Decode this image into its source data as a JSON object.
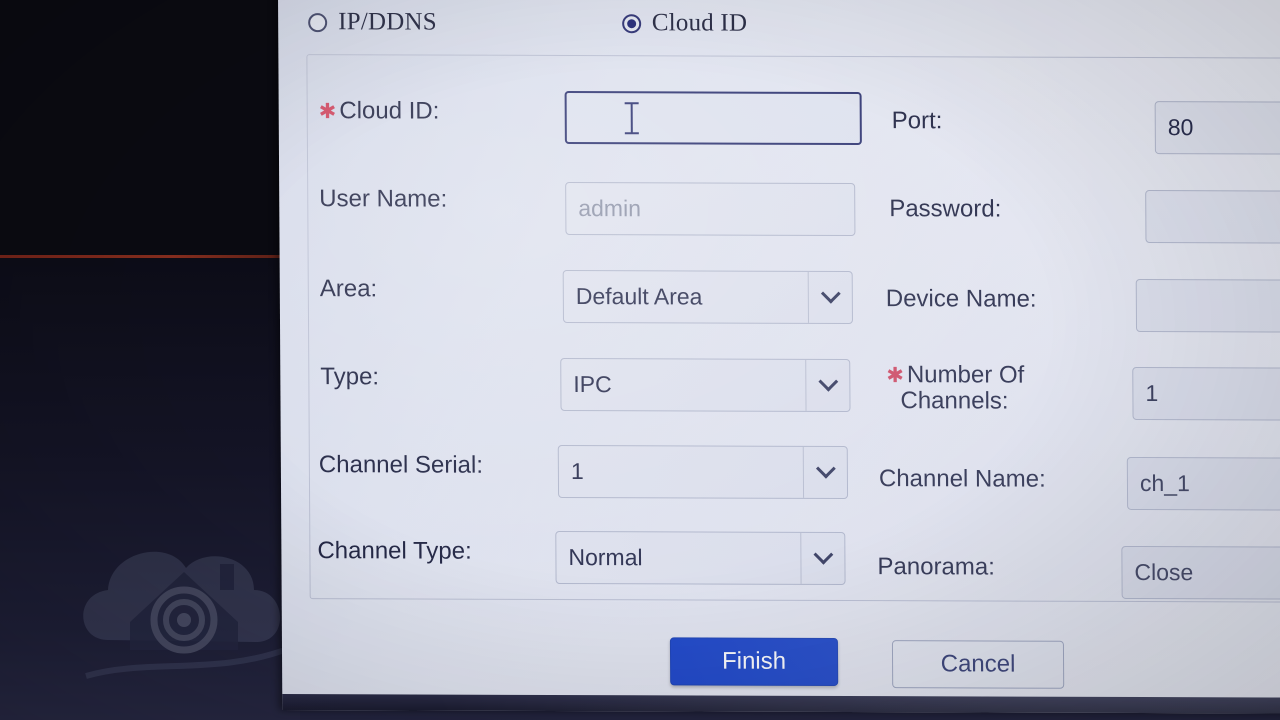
{
  "connection_mode": {
    "options": [
      {
        "label": "IP/DDNS",
        "selected": false
      },
      {
        "label": "Cloud ID",
        "selected": true
      }
    ]
  },
  "form": {
    "left_column": [
      {
        "label": "Cloud ID:",
        "required": true,
        "type": "text",
        "value": "",
        "placeholder": "",
        "focused": true
      },
      {
        "label": "User Name:",
        "required": false,
        "type": "text",
        "value": "admin",
        "placeholder": "admin",
        "focused": false
      },
      {
        "label": "Area:",
        "required": false,
        "type": "select",
        "value": "Default Area",
        "focused": false
      },
      {
        "label": "Type:",
        "required": false,
        "type": "select",
        "value": "IPC",
        "focused": false
      },
      {
        "label": "Channel Serial:",
        "required": false,
        "type": "select",
        "value": "1",
        "focused": false
      },
      {
        "label": "Channel Type:",
        "required": false,
        "type": "select",
        "value": "Normal",
        "focused": false
      }
    ],
    "right_column": [
      {
        "label": "Port:",
        "required": false,
        "type": "text",
        "value": "80",
        "focused": false
      },
      {
        "label": "Password:",
        "required": false,
        "type": "password",
        "value": "",
        "focused": false
      },
      {
        "label": "Device Name:",
        "required": false,
        "type": "text",
        "value": "",
        "focused": false
      },
      {
        "label": "Number Of Channels:",
        "label_line1": "Number Of",
        "label_line2": "Channels:",
        "required": true,
        "type": "text",
        "value": "1",
        "focused": false
      },
      {
        "label": "Channel Name:",
        "required": false,
        "type": "text",
        "value": "ch_1",
        "focused": false
      },
      {
        "label": "Panorama:",
        "required": false,
        "type": "select",
        "value": "Close",
        "focused": false
      }
    ]
  },
  "footer": {
    "finish_label": "Finish",
    "cancel_label": "Cancel"
  },
  "colors": {
    "primary_button": "#1540c8",
    "required_star": "#d0405a",
    "focus_border": "#2c3270",
    "dialog_background": "#dde1ee",
    "desktop_background": "#0c0c17"
  },
  "background": {
    "watermark_icon": "cloud-house-camera-icon"
  }
}
